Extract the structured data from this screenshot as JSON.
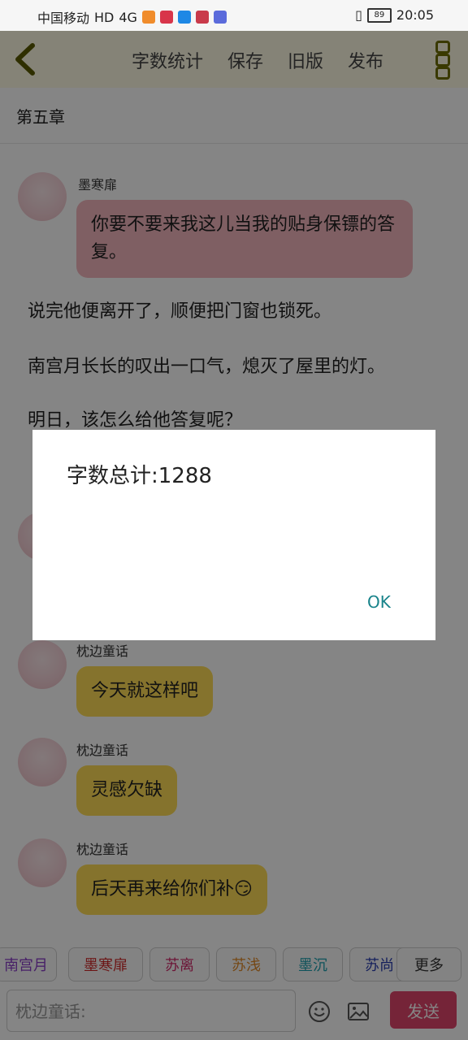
{
  "status_bar": {
    "carrier": "中国移动",
    "network": "HD",
    "signal": "4G",
    "battery": "89",
    "time": "20:05"
  },
  "top_bar": {
    "tabs": [
      "字数统计",
      "保存",
      "旧版",
      "发布"
    ]
  },
  "chapter_title": "第五章",
  "chat": {
    "first_message": {
      "sender": "墨寒扉",
      "text": "你要不要来我这儿当我的贴身保镖的答复。"
    },
    "narration": [
      "说完他便离开了，顺便把门窗也锁死。",
      "南宫月长长的叹出一口气，熄灭了屋里的灯。",
      "明日，该怎么给他答复呢？"
    ],
    "later_messages": [
      {
        "sender": "枕边童话",
        "text": "今天就这样吧"
      },
      {
        "sender": "枕边童话",
        "text": "灵感欠缺"
      },
      {
        "sender": "枕边童话",
        "text": "后天再来给你们补😏"
      }
    ]
  },
  "dialog": {
    "message": "字数总计:1288",
    "ok_label": "OK"
  },
  "role_chips": [
    "南宫月",
    "墨寒扉",
    "苏离",
    "苏浅",
    "墨沉",
    "苏尚",
    "更多"
  ],
  "input_bar": {
    "placeholder": "枕边童话:",
    "send_label": "发送"
  },
  "colors": {
    "topbar_bg": "#fffbe5",
    "pink_bubble": "#f3b7bf",
    "yellow_bubble": "#ffdd57",
    "send_button": "#e0456b",
    "ok_text": "#18838a"
  }
}
